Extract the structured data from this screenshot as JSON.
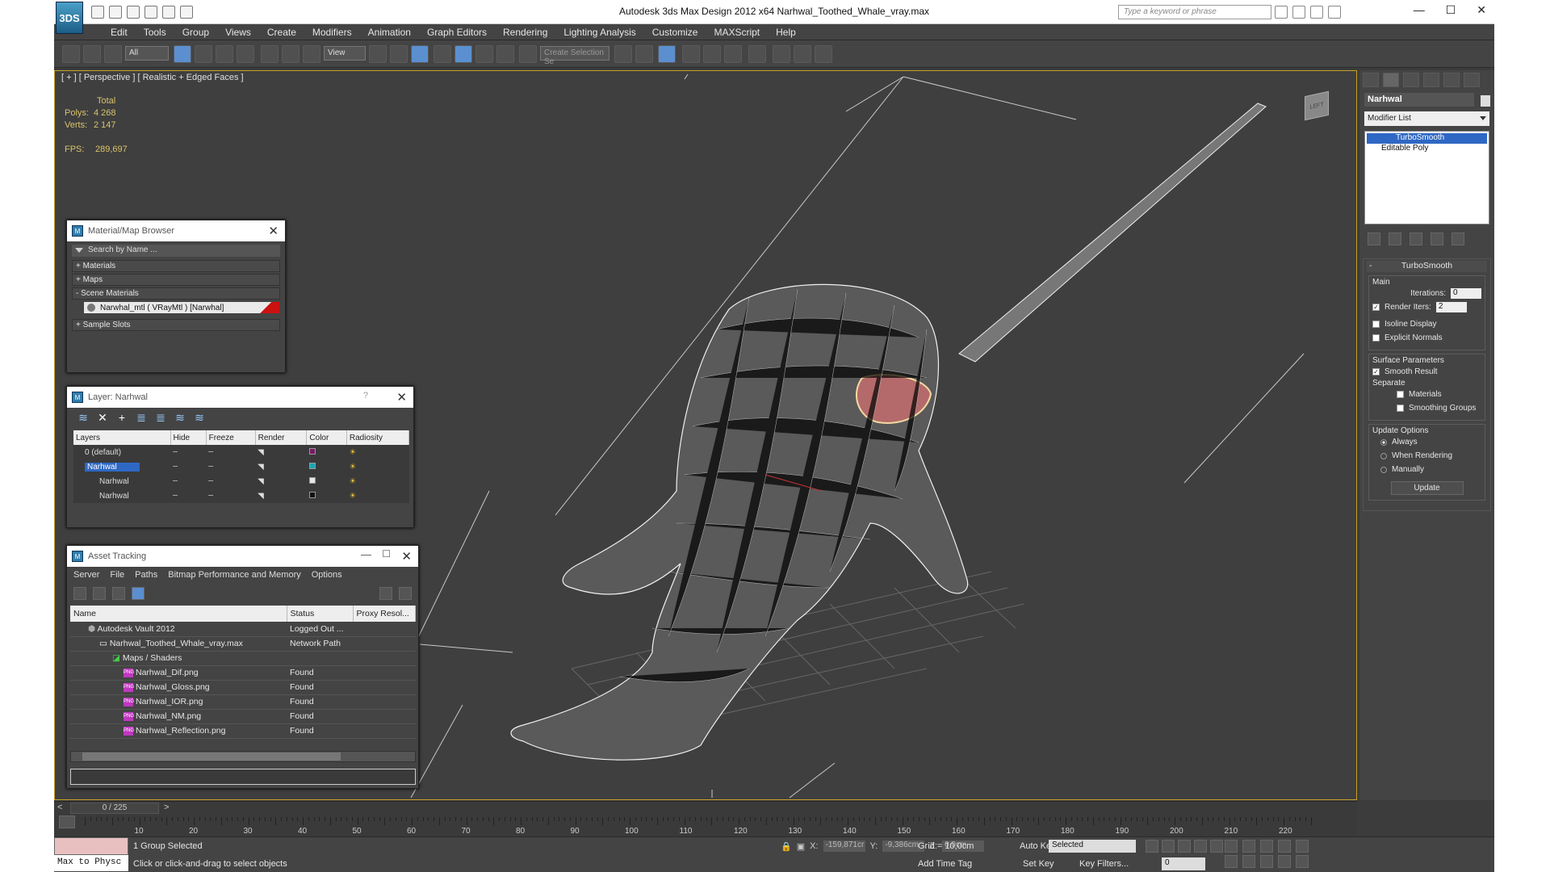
{
  "title": {
    "logo_text": "3DS",
    "window_title": "Autodesk 3ds Max Design 2012 x64      Narhwal_Toothed_Whale_vray.max",
    "search_placeholder": "Type a keyword or phrase",
    "minimize": "—",
    "maximize": "☐",
    "close": "✕"
  },
  "menu": [
    "Edit",
    "Tools",
    "Group",
    "Views",
    "Create",
    "Modifiers",
    "Animation",
    "Graph Editors",
    "Rendering",
    "Lighting Analysis",
    "Customize",
    "MAXScript",
    "Help"
  ],
  "toolbar": {
    "filter_value": "All",
    "refcoord_value": "View",
    "selection_set_placeholder": "Create Selection Se"
  },
  "viewport": {
    "label": "[ + ] [ Perspective ] [ Realistic + Edged Faces ]",
    "stats_header": "Total",
    "polys_label": "Polys:",
    "polys_value": "4 268",
    "verts_label": "Verts:",
    "verts_value": "2 147",
    "fps_label": "FPS:",
    "fps_value": "289,697",
    "viewcube_label": "LEFT"
  },
  "material_browser": {
    "title": "Material/Map Browser",
    "search_placeholder": "Search by Name ...",
    "groups": [
      "+ Materials",
      "+ Maps",
      "- Scene Materials"
    ],
    "material_item": "Narwhal_mtl  ( VRayMtl ) [Narwhal]",
    "sample_slots": "+ Sample Slots"
  },
  "layer_panel": {
    "title": "Layer: Narhwal",
    "help": "?",
    "columns": [
      "Layers",
      "Hide",
      "Freeze",
      "Render",
      "Color",
      "Radiosity"
    ],
    "rows": [
      {
        "name": "0 (default)",
        "color": "#7a1a6a"
      },
      {
        "name": "Narhwal",
        "color": "#1aa5b5"
      },
      {
        "name": "Narhwal",
        "color": "#e8e8e8"
      },
      {
        "name": "Narhwal",
        "color": "#111111"
      }
    ]
  },
  "asset_tracking": {
    "title": "Asset Tracking",
    "menu": [
      "Server",
      "File",
      "Paths",
      "Bitmap Performance and Memory",
      "Options"
    ],
    "columns": [
      "Name",
      "Status",
      "Proxy Resol..."
    ],
    "rows": [
      {
        "name": "Autodesk Vault 2012",
        "status": "Logged Out ...",
        "indent": 1
      },
      {
        "name": "Narhwal_Toothed_Whale_vray.max",
        "status": "Network Path",
        "indent": 2
      },
      {
        "name": "Maps / Shaders",
        "status": "",
        "indent": 3
      },
      {
        "name": "Narhwal_Dif.png",
        "status": "Found",
        "indent": 4
      },
      {
        "name": "Narhwal_Gloss.png",
        "status": "Found",
        "indent": 4
      },
      {
        "name": "Narhwal_IOR.png",
        "status": "Found",
        "indent": 4
      },
      {
        "name": "Narhwal_NM.png",
        "status": "Found",
        "indent": 4
      },
      {
        "name": "Narhwal_Reflection.png",
        "status": "Found",
        "indent": 4
      }
    ],
    "png_badge": "PNG"
  },
  "command_panel": {
    "object_name": "Narhwal",
    "modifier_list": "Modifier List",
    "stack": [
      "TurboSmooth",
      "Editable Poly"
    ],
    "rollout_title": "TurboSmooth",
    "main_label": "Main",
    "iterations_label": "Iterations:",
    "iterations_value": "0",
    "render_iters_label": "Render Iters:",
    "render_iters_value": "2",
    "isoline": "Isoline Display",
    "explicit_normals": "Explicit Normals",
    "surface_params": "Surface Parameters",
    "smooth_result": "Smooth Result",
    "separate": "Separate",
    "materials": "Materials",
    "smoothing_groups": "Smoothing Groups",
    "update_options": "Update Options",
    "always": "Always",
    "when_rendering": "When Rendering",
    "manually": "Manually",
    "update_btn": "Update",
    "check": "✓"
  },
  "timeline": {
    "slider_label": "0 / 225",
    "prev": "<",
    "next": ">",
    "ticks": [
      "10",
      "20",
      "30",
      "40",
      "50",
      "60",
      "70",
      "80",
      "90",
      "100",
      "110",
      "120",
      "130",
      "140",
      "150",
      "160",
      "170",
      "180",
      "190",
      "200",
      "210",
      "220"
    ]
  },
  "status": {
    "maxscript": "Max to Physc",
    "selection": "1 Group Selected",
    "prompt": "Click or click-and-drag to select objects",
    "x_label": "X:",
    "x_value": "-159,871cr",
    "y_label": "Y:",
    "y_value": "-9,386cm",
    "z_label": "Z:",
    "z_value": "0,0cm",
    "grid": "Grid = 10,0cm",
    "add_time_tag": "Add Time Tag",
    "auto_key": "Auto Key",
    "set_key": "Set Key",
    "auto_key_dropdown": "Selected",
    "key_filters": "Key Filters...",
    "frame": "0"
  }
}
